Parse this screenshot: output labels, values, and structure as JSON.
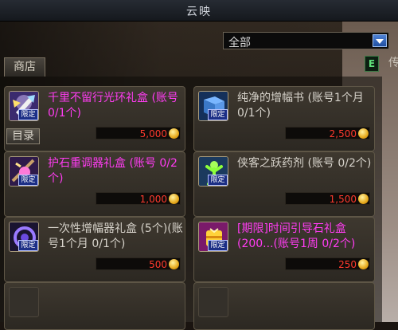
{
  "window": {
    "title": "云映"
  },
  "filter": {
    "selected": "全部"
  },
  "tabs": {
    "shop": "商店"
  },
  "catalog_label": "目录",
  "edge_glyph": "E",
  "edge_text": "传",
  "limited_badge": "限定",
  "items": [
    {
      "name": "千里不留行光环礼盒 (账号 0/1个)",
      "price": "5,000",
      "name_color": "#ff3cf2",
      "icon": "sword-aura-icon"
    },
    {
      "name": "纯净的增幅书 (账号1个月 0/1个)",
      "price": "2,500",
      "name_color": "#d6d2ca",
      "icon": "amplify-book-icon"
    },
    {
      "name": "护石重调器礼盒 (账号 0/2个)",
      "price": "1,000",
      "name_color": "#ff3cf2",
      "icon": "talisman-tuner-icon"
    },
    {
      "name": "侠客之跃药剂 (账号 0/2个)",
      "price": "1,500",
      "name_color": "#d6d2ca",
      "icon": "jump-potion-icon"
    },
    {
      "name": "一次性增幅器礼盒 (5个)(账号1个月 0/1个)",
      "price": "500",
      "name_color": "#d6d2ca",
      "icon": "amplifier-box-icon"
    },
    {
      "name": "[期限]时间引导石礼盒 (200...(账号1周 0/2个)",
      "price": "250",
      "name_color": "#ff3cf2",
      "icon": "time-stone-box-icon"
    }
  ],
  "colors": {
    "price": "#ff3a2e",
    "limited_badge_bg": "#1c2f86"
  }
}
